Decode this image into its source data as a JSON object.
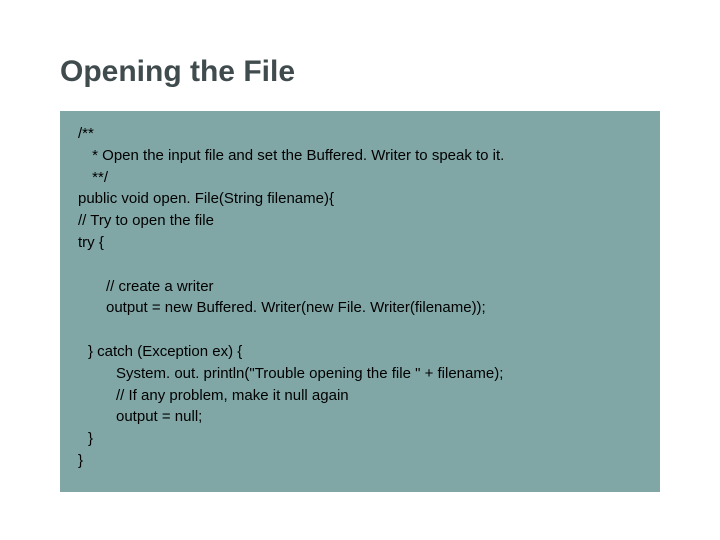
{
  "title": "Opening the File",
  "code": {
    "l1": "/**",
    "l2": " * Open the input file and set the Buffered. Writer to speak to it.",
    "l3": " **/",
    "l4": "public void open. File(String filename){",
    "l5": "// Try to open the file",
    "l6": "try {",
    "l7": "// create a writer",
    "l8": "output = new Buffered. Writer(new File. Writer(filename));",
    "l9": "} catch (Exception ex) {",
    "l10": "System. out. println(\"Trouble opening the file \" + filename);",
    "l11": "// If any problem, make it null again",
    "l12": "output = null;",
    "l13": "}",
    "l14": "}"
  }
}
